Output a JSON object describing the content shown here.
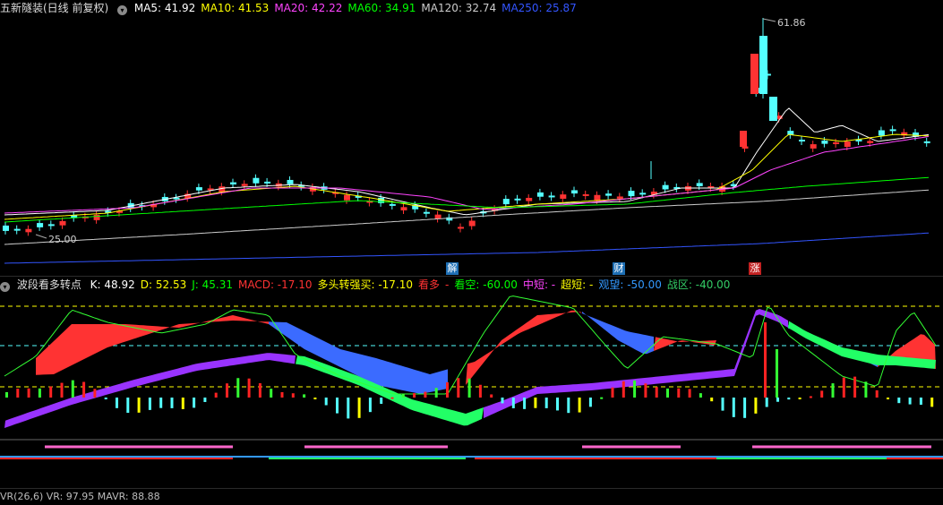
{
  "main_header": {
    "title": "五新隧装(日线 前复权)",
    "ma": [
      {
        "label": "MA5: 41.92",
        "color": "#ffffff"
      },
      {
        "label": "MA10: 41.53",
        "color": "#ffff00"
      },
      {
        "label": "MA20: 42.22",
        "color": "#ff44ff"
      },
      {
        "label": "MA60: 34.91",
        "color": "#00ff00"
      },
      {
        "label": "MA120: 32.74",
        "color": "#cccccc"
      },
      {
        "label": "MA250: 25.87",
        "color": "#3355ff"
      }
    ]
  },
  "price_annotations": {
    "high": "61.86",
    "low": "25.00"
  },
  "events": [
    {
      "label": "解",
      "bg": "#1e6fb4",
      "color": "#ffffff"
    },
    {
      "label": "财",
      "bg": "#1e6fb4",
      "color": "#ffffff"
    },
    {
      "label": "涨",
      "bg": "#c22222",
      "color": "#ffffff"
    }
  ],
  "indicator_header": {
    "name": "波段看多转点",
    "items": [
      {
        "label": "K: 48.92",
        "color": "#ffffff"
      },
      {
        "label": "D: 52.53",
        "color": "#ffff00"
      },
      {
        "label": "J: 45.31",
        "color": "#00ff00"
      },
      {
        "label": "MACD: -17.10",
        "color": "#ff3333"
      },
      {
        "label": "多头转强买: -17.10",
        "color": "#ffff00"
      },
      {
        "label": "看多",
        "color": "#ff3333"
      },
      {
        "label": "-",
        "color": "#ff3333"
      },
      {
        "label": "看空: -60.00",
        "color": "#00ff00"
      },
      {
        "label": "中短: -",
        "color": "#ff44ff"
      },
      {
        "label": "超短: -",
        "color": "#ffff00"
      },
      {
        "label": "观望: -50.00",
        "color": "#3399ff"
      },
      {
        "label": "战区: -40.00",
        "color": "#33cc66"
      }
    ]
  },
  "vr_header": {
    "label": "VR(26,6)  VR: 97.95  MAVR: 88.88"
  },
  "colors": {
    "up": "#ff3333",
    "down": "#54ffff",
    "background": "#000000"
  }
}
